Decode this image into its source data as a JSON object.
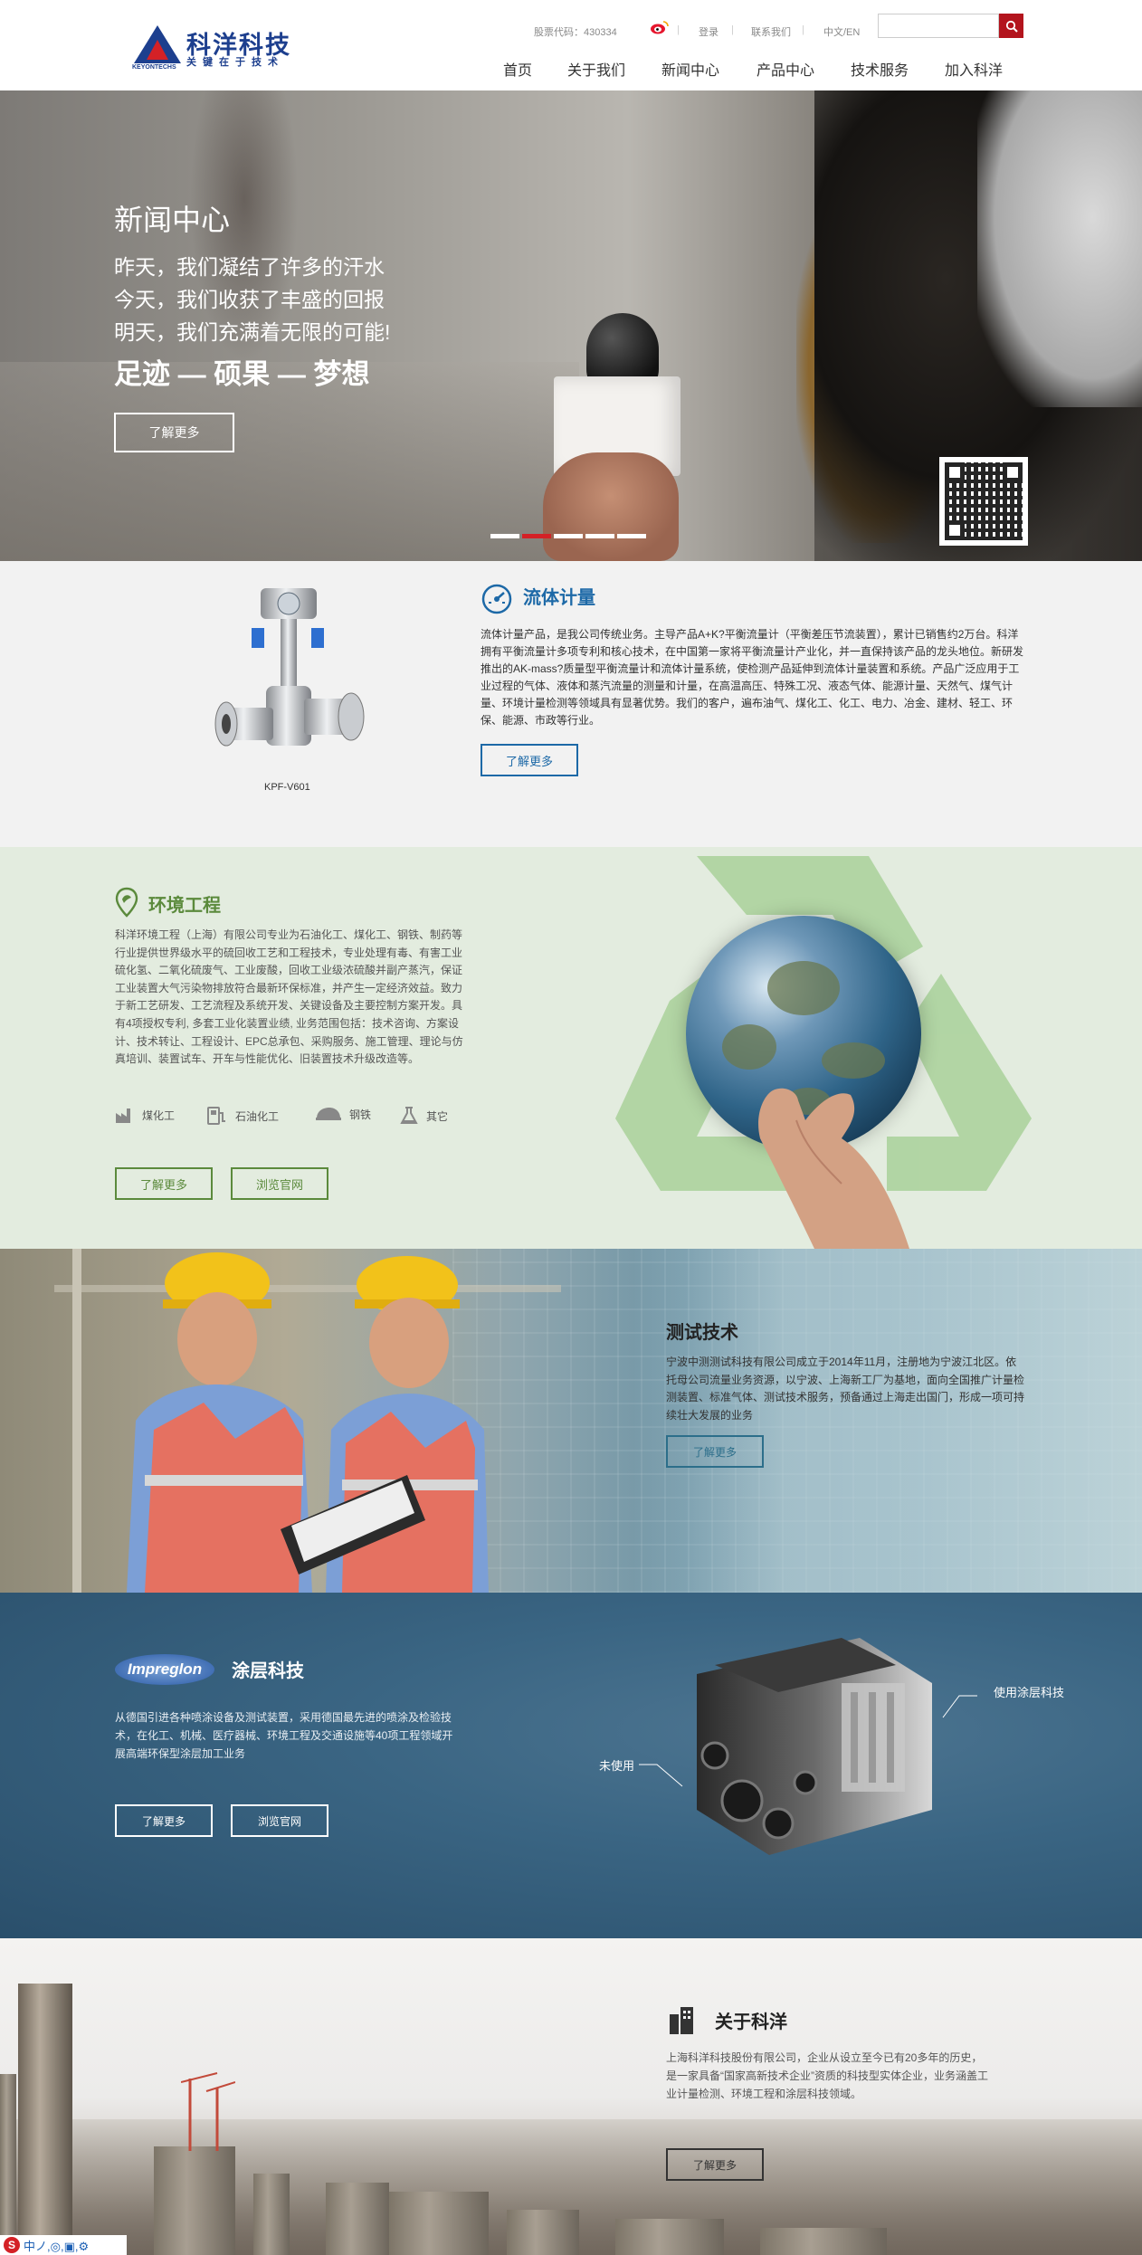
{
  "header": {
    "logo": {
      "cn": "科洋科技",
      "slogan": "关键在于技术",
      "en": "KEYONTECHS"
    },
    "stock_label": "股票代码：430334",
    "login": "登录",
    "contact": "联系我们",
    "lang": "中文/EN",
    "search_placeholder": "",
    "nav": [
      "首页",
      "关于我们",
      "新闻中心",
      "产品中心",
      "技术服务",
      "加入科洋"
    ]
  },
  "hero": {
    "title": "新闻中心",
    "lines": [
      "昨天，我们凝结了许多的汗水",
      "今天，我们收获了丰盛的回报",
      "明天，我们充满着无限的可能!"
    ],
    "big": "足迹 — 硕果 — 梦想",
    "button": "了解更多",
    "slides": 5,
    "active_slide": 2
  },
  "flow": {
    "title": "流体计量",
    "product_caption": "KPF-V601",
    "text": "流体计量产品，是我公司传统业务。主导产品A+K?平衡流量计（平衡差压节流装置），累计已销售约2万台。科洋拥有平衡流量计多项专利和核心技术，在中国第一家将平衡流量计产业化，并一直保持该产品的龙头地位。新研发推出的AK-mass?质量型平衡流量计和流体计量系统，使检测产品延伸到流体计量装置和系统。产品广泛应用于工业过程的气体、液体和蒸汽流量的测量和计量，在高温高压、特殊工况、液态气体、能源计量、天然气、煤气计量、环境计量检测等领域具有显著优势。我们的客户，遍布油气、煤化工、化工、电力、冶金、建材、轻工、环保、能源、市政等行业。",
    "button": "了解更多"
  },
  "env": {
    "title": "环境工程",
    "text": "科洋环境工程（上海）有限公司专业为石油化工、煤化工、钢铁、制药等行业提供世界级水平的硫回收工艺和工程技术，专业处理有毒、有害工业硫化氢、二氧化硫废气、工业废酸，回收工业级浓硫酸并副产蒸汽，保证工业装置大气污染物排放符合最新环保标准，并产生一定经济效益。致力于新工艺研发、工艺流程及系统开发、关键设备及主要控制方案开发。具有4项授权专利, 多套工业化装置业绩, 业务范围包括：技术咨询、方案设计、技术转让、工程设计、EPC总承包、采购服务、施工管理、理论与仿真培训、装置试车、开车与性能优化、旧装置技术升级改造等。",
    "categories": [
      "煤化工",
      "石油化工",
      "钢铁",
      "其它"
    ],
    "button_more": "了解更多",
    "button_site": "浏览官网"
  },
  "test": {
    "title": "测试技术",
    "text": "宁波中测测试科技有限公司成立于2014年11月，注册地为宁波江北区。依托母公司流量业务资源，以宁波、上海新工厂为基地，面向全国推广计量检测装置、标准气体、测试技术服务，预备通过上海走出国门，形成一项可持续壮大发展的业务",
    "button": "了解更多"
  },
  "coating": {
    "logo_text": "Impreglon",
    "title": "涂层科技",
    "text": "从德国引进各种喷涂设备及测试装置，采用德国最先进的喷涂及检验技术，在化工、机械、医疗器械、环境工程及交通设施等40项工程领域开展高端环保型涂层加工业务",
    "label_used": "使用涂层科技",
    "label_unused": "未使用",
    "button_more": "了解更多",
    "button_site": "浏览官网"
  },
  "about": {
    "title": "关于科洋",
    "text": "上海科洋科技股份有限公司，企业从设立至今已有20多年的历史，是一家具备“国家高新技术企业”资质的科技型实体企业，业务涵盖工业计量检测、环境工程和涂层科技领域。",
    "button": "了解更多"
  },
  "corner": {
    "text": "中ノ,◎,▣,⚙"
  },
  "colors": {
    "brand_blue": "#1d3f8e",
    "brand_red": "#b3141d",
    "flow_blue": "#1d69a7",
    "env_green": "#5b8a3c"
  }
}
